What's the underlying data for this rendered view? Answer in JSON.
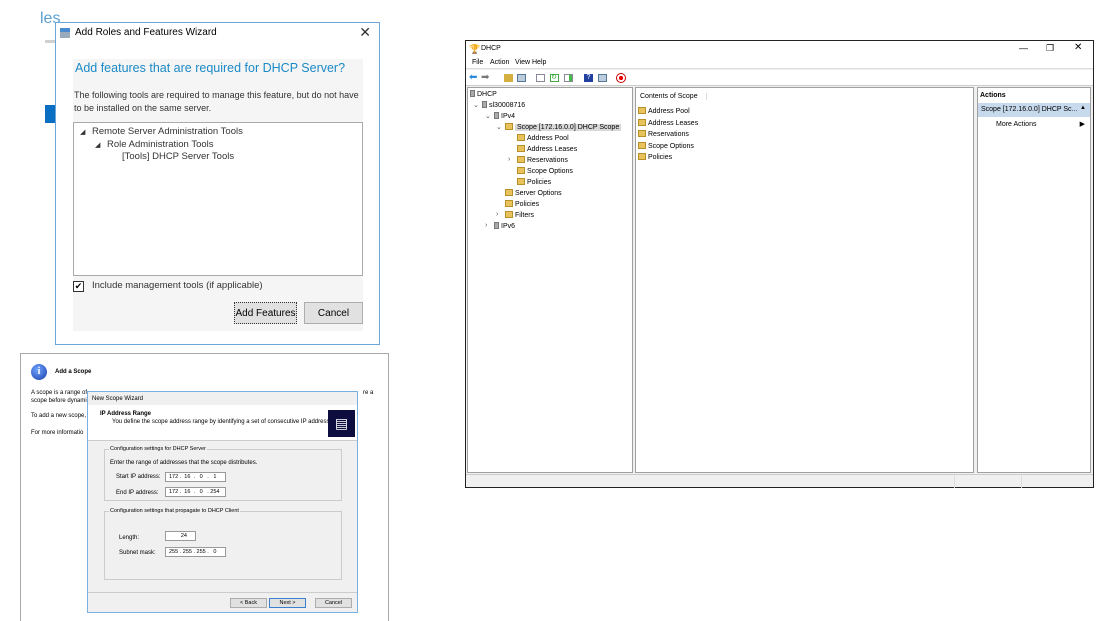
{
  "background": {
    "partial_text": "les"
  },
  "roles_wizard": {
    "title": "Add Roles and Features Wizard",
    "heading": "Add features that are required for DHCP Server?",
    "description": "The following tools are required to manage this feature, but do not have to be installed on the same server.",
    "tree": [
      {
        "label": "Remote Server Administration Tools",
        "level": 0,
        "expanded": true
      },
      {
        "label": "Role Administration Tools",
        "level": 1,
        "expanded": true
      },
      {
        "label": "[Tools] DHCP Server Tools",
        "level": 2,
        "expanded": false
      }
    ],
    "include_tools_label": "Include management tools (if applicable)",
    "include_tools_checked": true,
    "add_features_label": "Add Features",
    "cancel_label": "Cancel",
    "accent": "#1a8ac6"
  },
  "add_scope": {
    "title": "Add a Scope",
    "line1a": "A scope is a range of",
    "line1b": "re a",
    "line2": "scope before dynami",
    "line3": "To add a new scope,",
    "line4": "For more informatio",
    "wizard": {
      "title": "New Scope Wizard",
      "heading": "IP Address Range",
      "subheading": "You define the scope address range by identifying a set of consecutive IP addresses.",
      "server_group": "Configuration settings for DHCP Server",
      "range_desc": "Enter the range of addresses that the scope distributes.",
      "start_label": "Start IP address:",
      "start_value": "172 .  16  .   0   .   1",
      "end_label": "End IP address:",
      "end_value": "172 .  16  .   0   . 254",
      "client_group": "Configuration settings that propagate to DHCP Client",
      "length_label": "Length:",
      "length_value": "24",
      "mask_label": "Subnet mask:",
      "mask_value": "255 . 255 . 255 .   0",
      "back_label": "< Back",
      "next_label": "Next >",
      "cancel_label": "Cancel"
    }
  },
  "dhcp": {
    "title": "DHCP",
    "menu": [
      "File",
      "Action",
      "View",
      "Help"
    ],
    "tree": [
      {
        "label": "DHCP",
        "indent": 0,
        "chev": ""
      },
      {
        "label": "sl30008716",
        "indent": 1,
        "chev": "v"
      },
      {
        "label": "IPv4",
        "indent": 2,
        "chev": "v"
      },
      {
        "label": "Scope [172.16.0.0] DHCP Scope",
        "indent": 3,
        "chev": "v",
        "selected": true
      },
      {
        "label": "Address Pool",
        "indent": 4,
        "chev": ""
      },
      {
        "label": "Address Leases",
        "indent": 4,
        "chev": ""
      },
      {
        "label": "Reservations",
        "indent": 4,
        "chev": ">"
      },
      {
        "label": "Scope Options",
        "indent": 4,
        "chev": ""
      },
      {
        "label": "Policies",
        "indent": 4,
        "chev": ""
      },
      {
        "label": "Server Options",
        "indent": 3,
        "chev": ""
      },
      {
        "label": "Policies",
        "indent": 3,
        "chev": ""
      },
      {
        "label": "Filters",
        "indent": 3,
        "chev": ">"
      },
      {
        "label": "IPv6",
        "indent": 2,
        "chev": ">"
      }
    ],
    "contents_header": "Contents of Scope",
    "contents": [
      "Address Pool",
      "Address Leases",
      "Reservations",
      "Scope Options",
      "Policies"
    ],
    "actions_header": "Actions",
    "actions_selected": "Scope [172.16.0.0] DHCP Sc...",
    "more_actions": "More Actions"
  }
}
